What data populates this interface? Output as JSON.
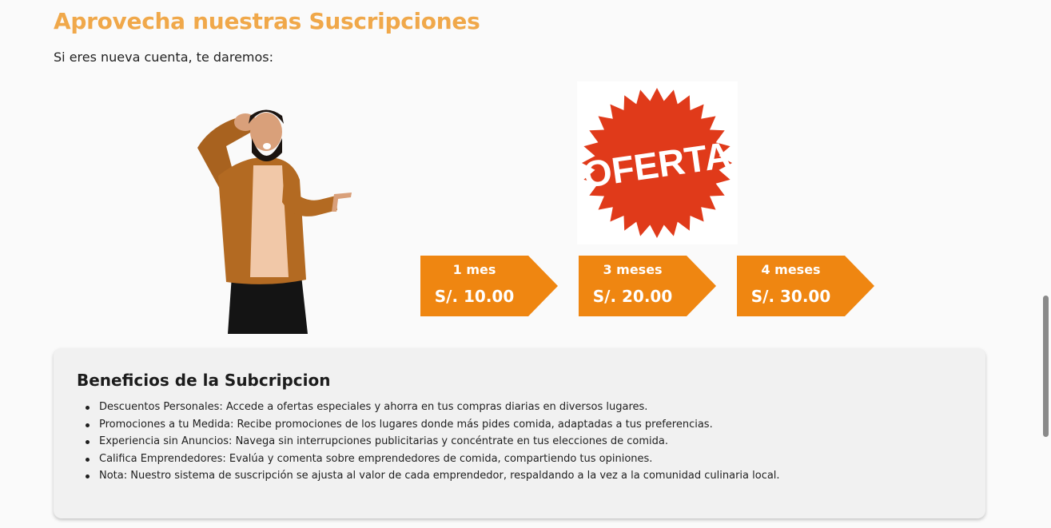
{
  "header": {
    "title": "Aprovecha nuestras Suscripciones",
    "intro": "Si eres nueva cuenta, te daremos:"
  },
  "images": {
    "person": "person-pointing-image",
    "offer_badge": {
      "text": "OFERTA",
      "color": "#e03a1a"
    }
  },
  "plans": [
    {
      "duration": "1 mes",
      "price": "S/. 10.00"
    },
    {
      "duration": "3 meses",
      "price": "S/. 20.00"
    },
    {
      "duration": "4 meses",
      "price": "S/. 30.00"
    }
  ],
  "benefits": {
    "title": "Beneficios de la Subcripcion",
    "items": [
      "Descuentos Personales: Accede a ofertas especiales y ahorra en tus compras diarias en diversos lugares.",
      "Promociones a tu Medida: Recibe promociones de los lugares donde más pides comida, adaptadas a tus preferencias.",
      "Experiencia sin Anuncios: Navega sin interrupciones publicitarias y concéntrate en tus elecciones de comida.",
      "Califica Emprendedores: Evalúa y comenta sobre emprendedores de comida, compartiendo tus opiniones.",
      "Nota: Nuestro sistema de suscripción se ajusta al valor de cada emprendedor, respaldando a la vez a la comunidad culinaria local."
    ]
  },
  "colors": {
    "title": "#f0a84a",
    "plan_background": "#ef8611",
    "panel_background": "#f1f1f1"
  }
}
